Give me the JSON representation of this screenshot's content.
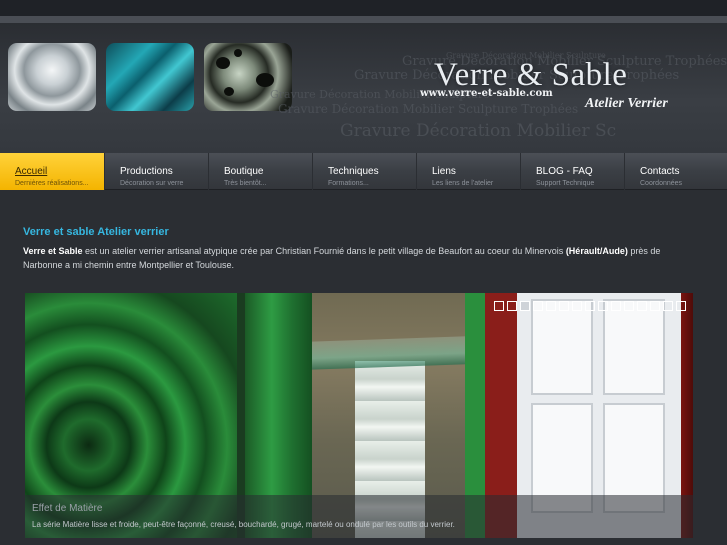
{
  "header": {
    "logo_title": "Verre & Sable",
    "logo_url": "www.verre-et-sable.com",
    "logo_subtitle": "Atelier Verrier",
    "background_words": [
      "Gravure Décoration Mobilier Sculpture",
      "Gravure Décoration Mobilier Sculpture Trophées",
      "Gravure Décoration Mobilier Sculpture Trophées",
      "Gravure Décoration Mobilier Sculpture",
      "Gravure Décoration Mobilier Sculpture Trophées",
      "Gravure Décoration Mobilier Sc"
    ]
  },
  "nav": {
    "items": [
      {
        "label": "Accueil",
        "desc": "Dernières réalisations..."
      },
      {
        "label": "Productions",
        "desc": "Décoration sur verre"
      },
      {
        "label": "Boutique",
        "desc": "Très bientôt..."
      },
      {
        "label": "Techniques",
        "desc": "Formations..."
      },
      {
        "label": "Liens",
        "desc": "Les liens de l'atelier"
      },
      {
        "label": "BLOG - FAQ",
        "desc": "Support Technique"
      },
      {
        "label": "Contacts",
        "desc": "Coordonnées"
      }
    ]
  },
  "content": {
    "title": "Verre et sable Atelier verrier",
    "intro_brand": "Verre et Sable",
    "intro_part1": " est un atelier verrier artisanal atypique crée par Christian Fournié dans le petit village de Beaufort au coeur du Minervois ",
    "intro_region": "(Hérault/Aude)",
    "intro_part2": " près de Narbonne a mi chemin entre Montpellier et Toulouse."
  },
  "slideshow": {
    "dot_count": 15,
    "active_dot": 3,
    "caption_title": "Effet de Matière",
    "caption_text": "La série Matière lisse et froide, peut-être façonné, creusé, bouchardé, grugé, martelé ou ondulé par les outils du verrier."
  }
}
